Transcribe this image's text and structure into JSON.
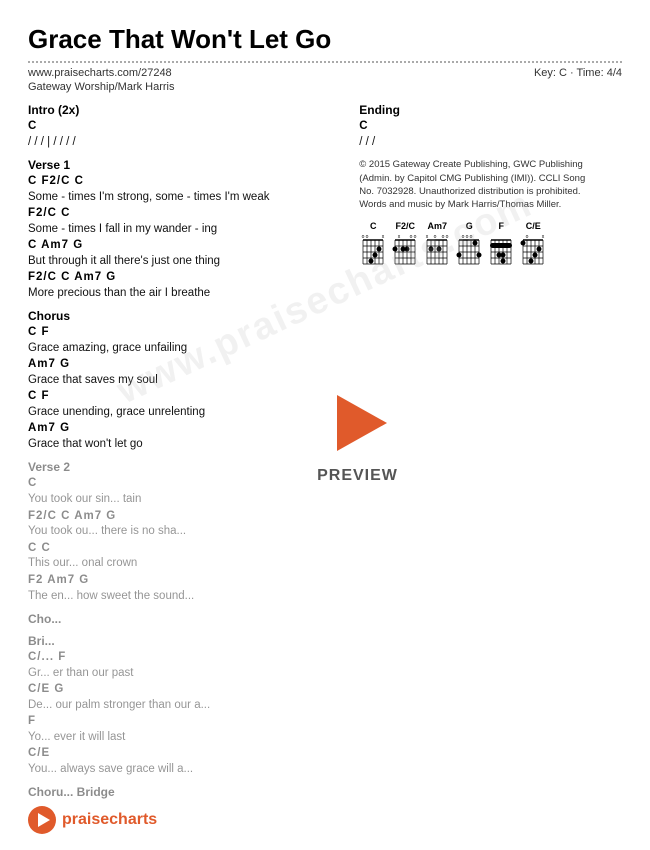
{
  "title": "Grace That Won't Let Go",
  "url": "www.praisecharts.com/27248",
  "key_time": "Key: C · Time: 4/4",
  "author": "Gateway Worship/Mark Harris",
  "sections": {
    "intro": {
      "title": "Intro (2x)",
      "chord_line": "C",
      "rhythm": "/ / / |  / / / /"
    },
    "verse1": {
      "title": "Verse 1",
      "lines": [
        {
          "chord": "        C                  F2/C      C",
          "lyric": "Some - times I'm strong, some - times I'm weak"
        },
        {
          "chord": "     F2/C           C",
          "lyric": "Some - times I fall in my wander - ing"
        },
        {
          "chord": "         C                    Am7      G",
          "lyric": "But through it all there's just one thing"
        },
        {
          "chord": "      F2/C         C         Am7   G",
          "lyric": "More precious than the  air  I breathe"
        }
      ]
    },
    "chorus": {
      "title": "Chorus",
      "lines": [
        {
          "chord": "C              F",
          "lyric": "Grace amazing, grace unfailing"
        },
        {
          "chord": "Am7               G",
          "lyric": "Grace that saves my soul"
        },
        {
          "chord": "C              F",
          "lyric": "Grace unending, grace unrelenting"
        },
        {
          "chord": "Am7               G",
          "lyric": "Grace that won't let go"
        }
      ]
    },
    "verse2": {
      "title": "Verse 2",
      "lines": [
        {
          "chord": "     C",
          "lyric": "You took our sin...",
          "faded": true
        },
        {
          "chord": "  F2/C    C        Am7    G",
          "lyric": "You took ou...   there is no sha...",
          "faded": true
        },
        {
          "chord": "       C    C",
          "lyric": "This our...",
          "faded": true
        },
        {
          "chord": "    F2            Am7     G",
          "lyric": "The en...     how sweet the sound...",
          "faded": true
        }
      ]
    },
    "chorus2": {
      "title": "Cho...",
      "faded": true
    },
    "bridge": {
      "title": "Bri...",
      "lines": [
        {
          "chord": "C/...                    F",
          "lyric": "Gr...    er than our past",
          "faded": true
        },
        {
          "chord": "           C/E              G",
          "lyric": "De...   our palm stronger than our a...",
          "faded": true
        },
        {
          "chord": "                      F",
          "lyric": "Yo...   ever it will last",
          "faded": true
        },
        {
          "chord": "           C/E",
          "lyric": "You...  always save grace will a...",
          "faded": true
        }
      ]
    },
    "chorus_bridge": {
      "title": "Choru...  Bridge",
      "faded": true
    },
    "ending": {
      "title": "Ending",
      "chord_line": "C",
      "rhythm": "/ / /"
    }
  },
  "copyright": "© 2015 Gateway Create Publishing, GWC Publishing (Admin. by Capitol CMG Publishing (IMI)). CCLI Song No. 7032928. Unauthorized distribution is prohibited. Words and music by Mark Harris/Thomas Miller.",
  "chord_diagrams": [
    {
      "name": "C",
      "fingers": [
        [
          1,
          2
        ],
        [
          2,
          4
        ],
        [
          0,
          3
        ],
        [
          0,
          2
        ],
        [
          3,
          1
        ],
        [
          0,
          0
        ]
      ]
    },
    {
      "name": "F2/C",
      "fingers": []
    },
    {
      "name": "Am7",
      "fingers": []
    },
    {
      "name": "G",
      "fingers": []
    },
    {
      "name": "F",
      "fingers": []
    },
    {
      "name": "C/E",
      "fingers": []
    }
  ],
  "watermark": "www.praisecharts.com",
  "preview_label": "PREVIEW",
  "logo_text_pre": "pr",
  "logo_text_brand": "aise",
  "logo_text_post": "charts"
}
